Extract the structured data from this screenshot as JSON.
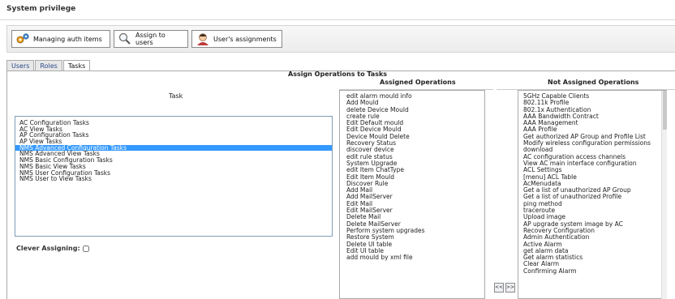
{
  "page": {
    "title": "System privilege"
  },
  "toolbar": {
    "managing_label": "Managing auth items",
    "assign_label": "Assign to users",
    "assignments_label": "User's assignments"
  },
  "tabs": [
    {
      "label": "Users",
      "active": false
    },
    {
      "label": "Roles",
      "active": false
    },
    {
      "label": "Tasks",
      "active": true
    }
  ],
  "main": {
    "heading": "Assign Operations to Tasks",
    "task_header": "Task",
    "assigned_header": "Assigned Operations",
    "not_assigned_header": "Not Assigned Operations",
    "clever_label": "Clever Assigning:",
    "move_left_label": "<<",
    "move_right_label": ">>"
  },
  "tasks": [
    "AC Configuration Tasks",
    "AC View Tasks",
    "AP Configuration Tasks",
    "AP View Tasks",
    "NMS Advanced Configuration Tasks",
    "NMS Advanced View Tasks",
    "NMS Basic Configuration Tasks",
    "NMS Basic View Tasks",
    "NMS User Configuration Tasks",
    "NMS User to View Tasks"
  ],
  "selected_task_index": 4,
  "assigned_operations": [
    "edit alarm mould info",
    "Add Mould",
    "delete Device Mould",
    "create rule",
    "Edit Default mould",
    "Edit Device Mould",
    "Device Mould Delete",
    "Recovery Status",
    "discover device",
    "edit rule status",
    "System Upgrade",
    "edit Item ChatType",
    "Edit Item Mould",
    "Discover Rule",
    "Add Mail",
    "Add MailServer",
    "Edit Mail",
    "Edit MailServer",
    "Delete Mail",
    "Delete MailServer",
    "Perform system upgrades",
    "Restore System",
    "Delete UI table",
    "Edit UI table",
    "add mould by xml file"
  ],
  "not_assigned_operations": [
    "5GHz Capable Clients",
    "802.11k Profile",
    "802.1x Authentication",
    "AAA Bandwidth Contract",
    "AAA Management",
    "AAA Profile",
    "Get authorized AP Group and Profile List",
    "Modify wireless configuration permissions",
    "download",
    "AC configuration access channels",
    "View AC main interface configuration",
    "ACL Settings",
    "[menu] ACL Table",
    "AcMenudata",
    "Get a list of unauthorized AP Group",
    "Get a list of unauthorized Profile",
    "ping method",
    "traceroute",
    "Upload image",
    "AP upgrade system image by AC",
    "Recovery Configuration",
    "Admin Authentication",
    "Active Alarm",
    "get alarm data",
    "Get alarm statistics",
    "Clear Alarm",
    "Confirming Alarm"
  ]
}
